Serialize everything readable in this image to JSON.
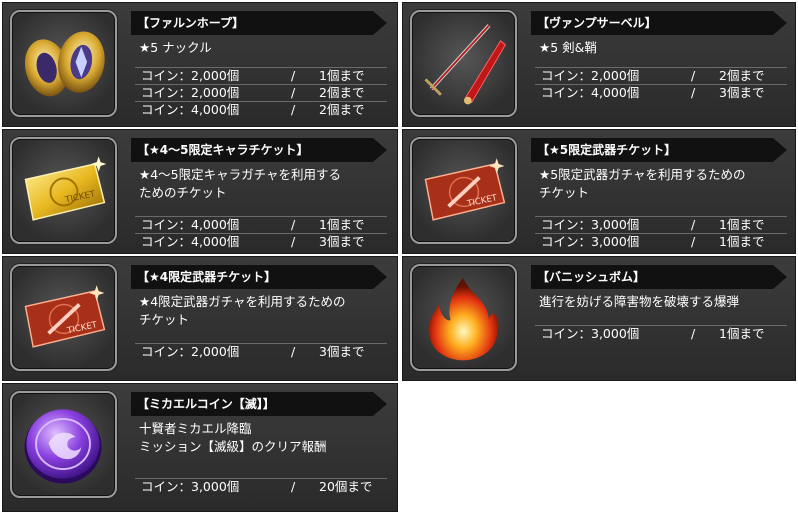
{
  "items": [
    {
      "title": "【ファルンホープ】",
      "desc": [
        "★5 ナックル"
      ],
      "prices": [
        {
          "coin": "コイン：2,000個",
          "sep": "/",
          "limit": "1個まで"
        },
        {
          "coin": "コイン：2,000個",
          "sep": "/",
          "limit": "2個まで"
        },
        {
          "coin": "コイン：4,000個",
          "sep": "/",
          "limit": "2個まで"
        }
      ],
      "icon": "golden-knuckle-icon"
    },
    {
      "title": "【ヴァンプサーベル】",
      "desc": [
        "★5 剣&鞘"
      ],
      "prices": [
        {
          "coin": "コイン：2,000個",
          "sep": "/",
          "limit": "2個まで"
        },
        {
          "coin": "コイン：4,000個",
          "sep": "/",
          "limit": "3個まで"
        }
      ],
      "icon": "red-sword-and-sheath-icon"
    },
    {
      "title": "【★4〜5限定キャラチケット】",
      "desc": [
        "★4〜5限定キャラガチャを利用する",
        "ためのチケット"
      ],
      "prices": [
        {
          "coin": "コイン：4,000個",
          "sep": "/",
          "limit": "1個まで"
        },
        {
          "coin": "コイン：4,000個",
          "sep": "/",
          "limit": "3個まで"
        }
      ],
      "icon": "gold-ticket-icon"
    },
    {
      "title": "【★5限定武器チケット】",
      "desc": [
        "★5限定武器ガチャを利用するための",
        "チケット"
      ],
      "prices": [
        {
          "coin": "コイン：3,000個",
          "sep": "/",
          "limit": "1個まで"
        },
        {
          "coin": "コイン：3,000個",
          "sep": "/",
          "limit": "1個まで"
        }
      ],
      "icon": "red-weapon-ticket-icon"
    },
    {
      "title": "【★4限定武器チケット】",
      "desc": [
        "★4限定武器ガチャを利用するための",
        "チケット"
      ],
      "prices": [
        {
          "coin": "コイン：2,000個",
          "sep": "/",
          "limit": "3個まで"
        }
      ],
      "icon": "red-weapon-ticket-icon"
    },
    {
      "title": "【バニッシュボム】",
      "desc": [
        "進行を妨げる障害物を破壊する爆弾"
      ],
      "prices": [
        {
          "coin": "コイン：3,000個",
          "sep": "/",
          "limit": "1個まで"
        }
      ],
      "icon": "fire-bomb-icon"
    },
    {
      "title": "【ミカエルコイン【滅】】",
      "desc": [
        "十賢者ミカエル降臨",
        "ミッション【滅級】のクリア報酬"
      ],
      "prices": [
        {
          "coin": "コイン：3,000個",
          "sep": "/",
          "limit": "20個まで"
        }
      ],
      "icon": "purple-coin-icon"
    }
  ],
  "colors": {
    "card_bg": "#333333",
    "title_bar_bg": "#111111",
    "text": "#ffffff",
    "divider": "#6a6a6a"
  }
}
